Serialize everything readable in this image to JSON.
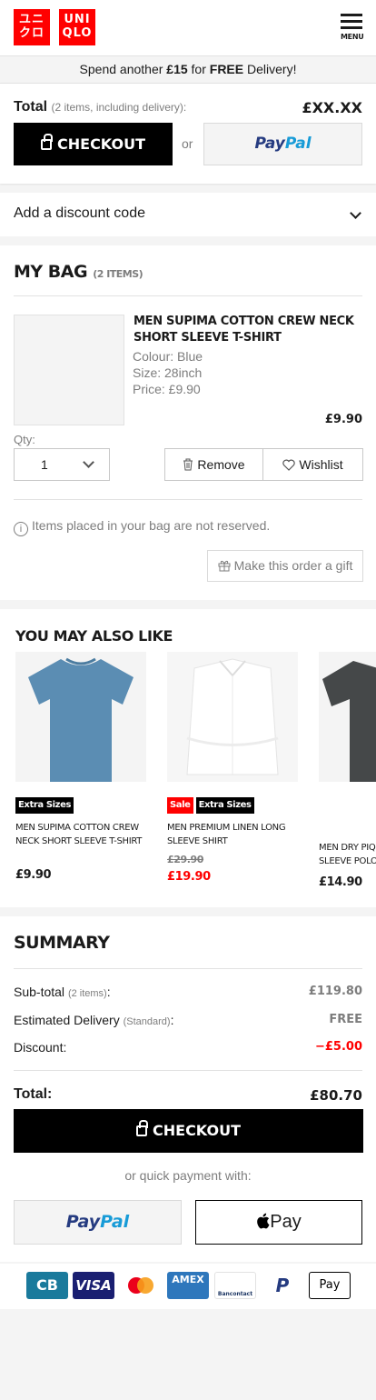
{
  "header": {
    "logo_left": "ユニ\nクロ",
    "logo_right": "UNI\nQLO",
    "menu_label": "MENU"
  },
  "promo": {
    "prefix": "Spend another ",
    "amount": "£15",
    "middle": " for ",
    "free": "FREE",
    "suffix": " Delivery!"
  },
  "total_bar": {
    "label": "Total",
    "sublabel": "(2 items, including delivery):",
    "value": "£XX.XX",
    "checkout_label": "CHECKOUT",
    "or_label": "or",
    "paypal_part1": "Pay",
    "paypal_part2": "Pal"
  },
  "discount": {
    "label": "Add a discount code"
  },
  "bag": {
    "title": "MY BAG",
    "count": "(2 ITEMS)",
    "item": {
      "name": "MEN SUPIMA COTTON CREW NECK SHORT SLEEVE T-SHIRT",
      "colour": "Colour: Blue",
      "size": "Size: 28inch",
      "price_line": "Price: £9.90",
      "price": "£9.90",
      "qty_label": "Qty:",
      "qty_value": "1",
      "remove_label": "Remove",
      "wishlist_label": "Wishlist"
    },
    "notice": "Items placed in your bag are not reserved.",
    "gift_label": "Make this order a gift"
  },
  "recommendations": {
    "title": "YOU MAY ALSO LIKE",
    "items": [
      {
        "badges": [
          "Extra Sizes"
        ],
        "name": "MEN SUPIMA COTTON CREW NECK SHORT SLEEVE T-SHIRT",
        "price": "£9.90",
        "color": "#5b8db3"
      },
      {
        "badges": [
          "Sale",
          "Extra Sizes"
        ],
        "name": "MEN PREMIUM LINEN LONG SLEEVE SHIRT",
        "old_price": "£29.90",
        "price": "£19.90",
        "color": "#f2f2f2"
      },
      {
        "badges": [],
        "name": "MEN DRY PIQUE SHORT SLEEVE POLO",
        "price": "£14.90",
        "color": "#454849"
      }
    ]
  },
  "summary": {
    "title": "SUMMARY",
    "subtotal_label": "Sub-total",
    "subtotal_note": "(2 items)",
    "subtotal_value": "£119.80",
    "delivery_label": "Estimated Delivery",
    "delivery_note": "(Standard)",
    "delivery_value": "FREE",
    "discount_label": "Discount:",
    "discount_value": "−£5.00",
    "total_label": "Total:",
    "total_value": "£80.70",
    "checkout_label": "CHECKOUT",
    "quick_label": "or quick payment with:",
    "paypal_part1": "Pay",
    "paypal_part2": "Pal",
    "applepay_label": "Pay"
  },
  "payments": [
    "CB",
    "VISA",
    "mastercard",
    "AMEX",
    "Bancontact",
    "P",
    "Pay"
  ],
  "colors": {
    "brand_red": "#ff0000",
    "paypal_dark": "#253b80",
    "paypal_light": "#179bd7"
  }
}
